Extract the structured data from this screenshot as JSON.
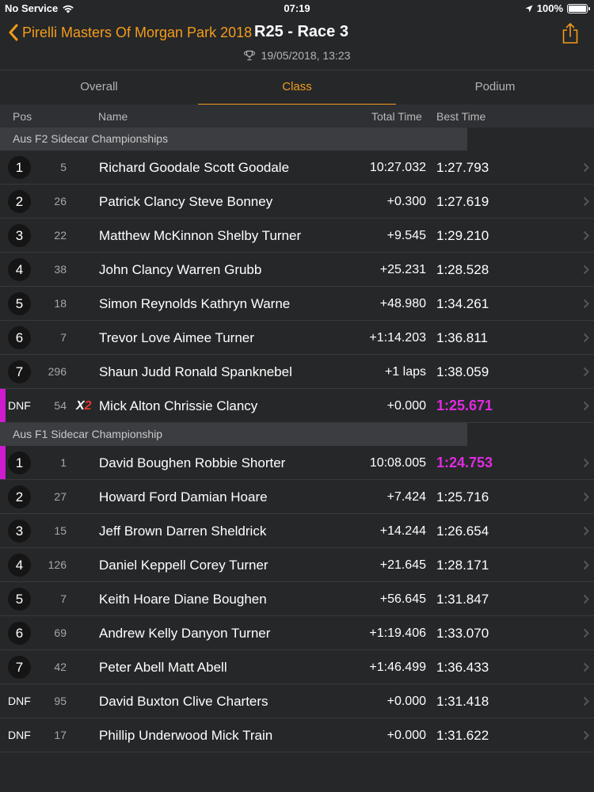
{
  "status": {
    "carrier": "No Service",
    "time": "07:19",
    "battery": "100%"
  },
  "nav": {
    "back_label": "Pirelli Masters Of Morgan Park 2018",
    "title": "R25 - Race 3",
    "subtitle": "19/05/2018, 13:23"
  },
  "tabs": [
    {
      "label": "Overall",
      "active": false
    },
    {
      "label": "Class",
      "active": true
    },
    {
      "label": "Podium",
      "active": false
    }
  ],
  "columns": {
    "pos": "Pos",
    "name": "Name",
    "total": "Total Time",
    "best": "Best Time"
  },
  "groups": [
    {
      "title": "Aus F2 Sidecar Championships",
      "rows": [
        {
          "pos": "1",
          "num": "5",
          "name": "Richard Goodale Scott Goodale",
          "total": "10:27.032",
          "best": "1:27.793"
        },
        {
          "pos": "2",
          "num": "26",
          "name": "Patrick Clancy Steve Bonney",
          "total": "+0.300",
          "best": "1:27.619"
        },
        {
          "pos": "3",
          "num": "22",
          "name": "Matthew McKinnon Shelby Turner",
          "total": "+9.545",
          "best": "1:29.210"
        },
        {
          "pos": "4",
          "num": "38",
          "name": "John Clancy Warren Grubb",
          "total": "+25.231",
          "best": "1:28.528"
        },
        {
          "pos": "5",
          "num": "18",
          "name": "Simon Reynolds Kathryn Warne",
          "total": "+48.980",
          "best": "1:34.261"
        },
        {
          "pos": "6",
          "num": "7",
          "name": "Trevor Love Aimee Turner",
          "total": "+1:14.203",
          "best": "1:36.811"
        },
        {
          "pos": "7",
          "num": "296",
          "name": "Shaun Judd Ronald Spanknebel",
          "total": "+1 laps",
          "best": "1:38.059"
        },
        {
          "pos": "DNF",
          "num": "54",
          "penalty": "X",
          "penalty_count": "2",
          "name": "Mick Alton Chrissie Clancy",
          "total": "+0.000",
          "best": "1:25.671",
          "fastest": true
        }
      ]
    },
    {
      "title": "Aus F1 Sidecar Championship",
      "rows": [
        {
          "pos": "1",
          "num": "1",
          "name": "David Boughen Robbie Shorter",
          "total": "10:08.005",
          "best": "1:24.753",
          "fastest": true
        },
        {
          "pos": "2",
          "num": "27",
          "name": "Howard Ford Damian Hoare",
          "total": "+7.424",
          "best": "1:25.716"
        },
        {
          "pos": "3",
          "num": "15",
          "name": "Jeff Brown Darren Sheldrick",
          "total": "+14.244",
          "best": "1:26.654"
        },
        {
          "pos": "4",
          "num": "126",
          "name": "Daniel Keppell Corey Turner",
          "total": "+21.645",
          "best": "1:28.171"
        },
        {
          "pos": "5",
          "num": "7",
          "name": "Keith Hoare Diane Boughen",
          "total": "+56.645",
          "best": "1:31.847"
        },
        {
          "pos": "6",
          "num": "69",
          "name": "Andrew Kelly Danyon Turner",
          "total": "+1:19.406",
          "best": "1:33.070"
        },
        {
          "pos": "7",
          "num": "42",
          "name": "Peter Abell Matt Abell",
          "total": "+1:46.499",
          "best": "1:36.433"
        },
        {
          "pos": "DNF",
          "num": "95",
          "name": "David Buxton Clive Charters",
          "total": "+0.000",
          "best": "1:31.418"
        },
        {
          "pos": "DNF",
          "num": "17",
          "name": "Phillip Underwood Mick Train",
          "total": "+0.000",
          "best": "1:31.622"
        }
      ]
    }
  ],
  "colors": {
    "accent": "#f39c1b",
    "fastest": "#e02be0",
    "penalty": "#e8342f",
    "background": "#262729"
  }
}
